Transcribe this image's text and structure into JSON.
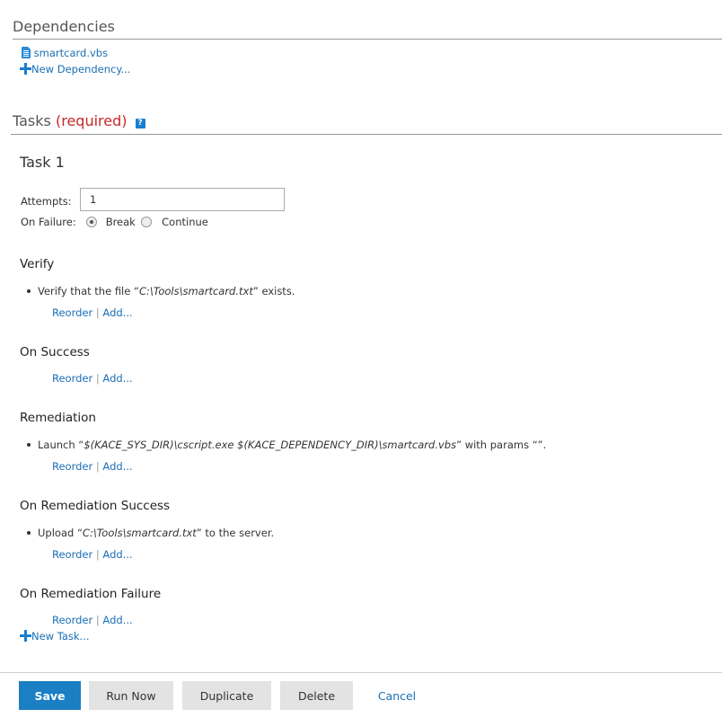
{
  "dependencies": {
    "title": "Dependencies",
    "file_name": "smartcard.vbs",
    "new_label": "New Dependency..."
  },
  "tasks": {
    "title": "Tasks",
    "required": "(required)",
    "help": "?",
    "new_task_label": "New Task...",
    "task1": {
      "title": "Task 1",
      "attempts_label": "Attempts:",
      "attempts_value": "1",
      "on_failure_label": "On Failure:",
      "break_label": "Break",
      "continue_label": "Continue",
      "selected": "Break"
    },
    "verify": {
      "title": "Verify",
      "item_prefix": "Verify that the file “",
      "item_path": "C:\\Tools\\smartcard.txt",
      "item_suffix": "” exists."
    },
    "on_success": {
      "title": "On Success"
    },
    "remediation": {
      "title": "Remediation",
      "item_prefix": "Launch “",
      "item_cmd": "$(KACE_SYS_DIR)\\cscript.exe $(KACE_DEPENDENCY_DIR)\\smartcard.vbs",
      "item_suffix": "” with params “”."
    },
    "on_remediation_success": {
      "title": "On Remediation Success",
      "item_prefix": "Upload “",
      "item_path": "C:\\Tools\\smartcard.txt",
      "item_suffix": "” to the server."
    },
    "on_remediation_failure": {
      "title": "On Remediation Failure"
    }
  },
  "actions": {
    "reorder": "Reorder",
    "separator": "|",
    "add": "Add..."
  },
  "footer": {
    "save": "Save",
    "run_now": "Run Now",
    "duplicate": "Duplicate",
    "delete": "Delete",
    "cancel": "Cancel"
  },
  "colors": {
    "primary": "#1b7fc4",
    "link": "#1a6fb5",
    "required": "#c62828"
  },
  "icons": {
    "file": "file-icon",
    "add": "plus-icon",
    "help": "help-icon"
  }
}
